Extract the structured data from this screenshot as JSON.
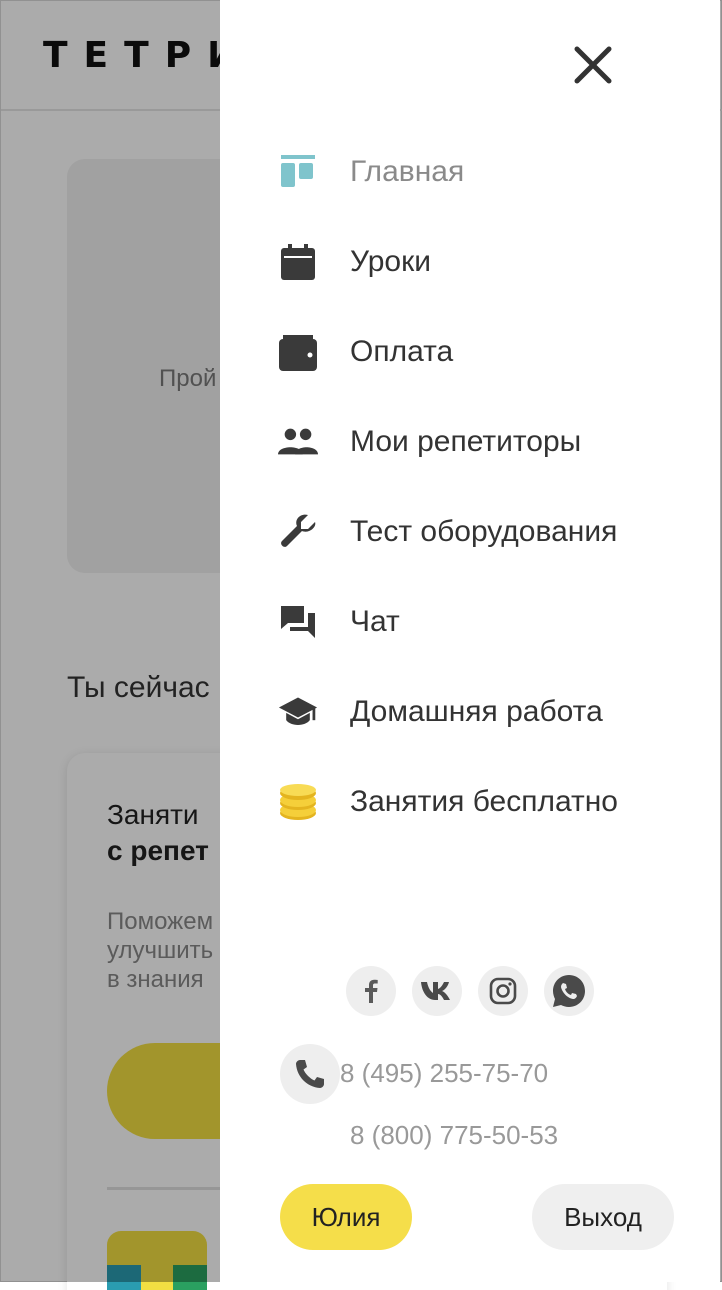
{
  "background": {
    "logo": "ТЕТРИ",
    "card_text": "Прой",
    "subtitle": "Ты сейчас",
    "card2_title_line1": "Заняти",
    "card2_title_line2": "с репет",
    "card2_text_lines": [
      "Поможем",
      "улучшить",
      "в знания"
    ]
  },
  "drawer": {
    "menu": [
      {
        "label": "Главная",
        "icon": "home-dashboard-icon",
        "active": true
      },
      {
        "label": "Уроки",
        "icon": "calendar-icon"
      },
      {
        "label": "Оплата",
        "icon": "wallet-icon"
      },
      {
        "label": "Мои репетиторы",
        "icon": "people-icon"
      },
      {
        "label": "Тест оборудования",
        "icon": "wrench-icon"
      },
      {
        "label": "Чат",
        "icon": "chat-icon"
      },
      {
        "label": "Домашняя работа",
        "icon": "graduation-cap-icon"
      },
      {
        "label": "Занятия бесплатно",
        "icon": "coins-icon"
      }
    ],
    "social": [
      "facebook-icon",
      "vk-icon",
      "instagram-icon",
      "whatsapp-icon"
    ],
    "phones": [
      "8 (495) 255-75-70",
      "8 (800) 775-50-53"
    ],
    "user_button": "Юлия",
    "logout_button": "Выход"
  },
  "colors": {
    "accent_yellow": "#f5de4a",
    "home_icon_teal": "#7fc4cc",
    "text": "#333333",
    "muted": "#8a8a8a"
  }
}
